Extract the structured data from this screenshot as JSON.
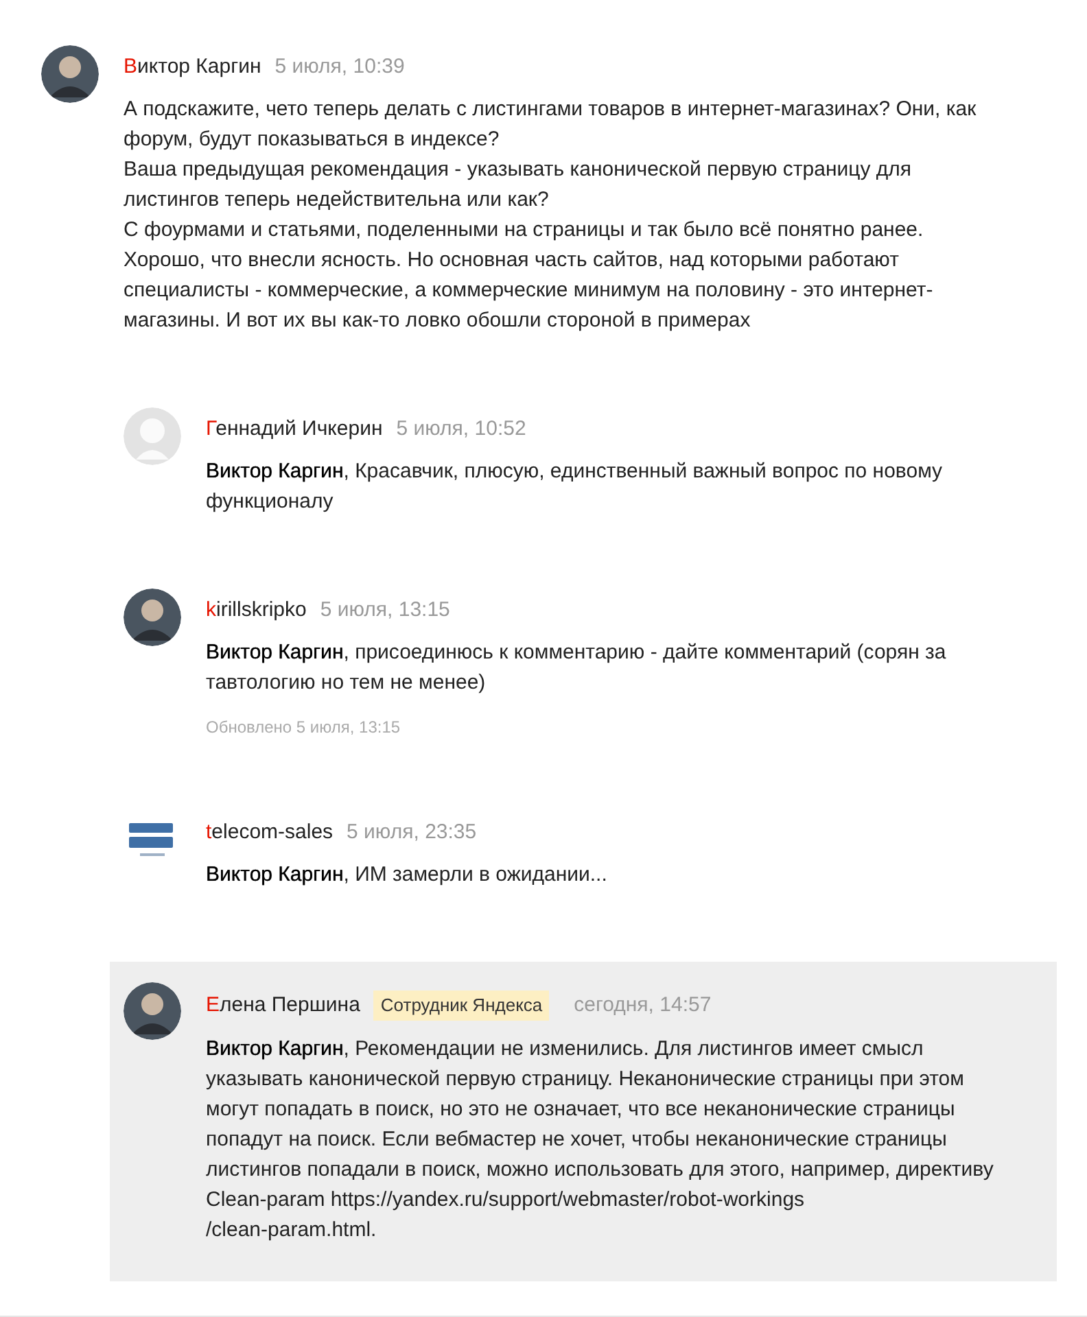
{
  "comments": [
    {
      "author": "Виктор Каргин",
      "time": "5 июля, 10:39",
      "reply": false,
      "highlighted": false,
      "text": "А подскажите, чето теперь делать с листингами товаров в интернет-магазинах? Они, как форум, будут показываться в индексе?\nВаша предыдущая рекомендация - указывать канонической первую страницу для листингов теперь недействительна или как?\nС фоурмами и статьями, поделенными на страницы и так было всё понятно ранее.\nХорошо, что внесли ясность. Но основная часть сайтов, над которыми работают специалисты - коммерческие, а коммерческие минимум на половину - это интернет-магазины. И вот их вы как-то ловко обошли стороной в примерах"
    },
    {
      "author": "Геннадий Ичкерин",
      "avatar": {
        "kind": "default"
      },
      "time": "5 июля, 10:52",
      "reply": true,
      "highlighted": false,
      "text": "**Виктор Каргин**, Красавчик, плюсую, единственный важный вопрос по новому функционалу"
    },
    {
      "author": "kirillskripko",
      "time": "5 июля, 13:15",
      "reply": true,
      "highlighted": false,
      "text": "**Виктор Каргин**, присоединюсь к комментарию - дайте комментарий (сорян за тавтологию но тем не менее)",
      "updated": "Обновлено 5 июля, 13:15"
    },
    {
      "author": "telecom-sales",
      "avatar": {
        "kind": "logo"
      },
      "time": "5 июля, 23:35",
      "reply": true,
      "highlighted": false,
      "text": "**Виктор Каргин**,  ИМ замерли в ожидании..."
    },
    {
      "author": "Елена Першина",
      "badge": "Сотрудник Яндекса",
      "time": "сегодня, 14:57",
      "reply": true,
      "highlighted": true,
      "text": "**Виктор Каргин**, Рекомендации не изменились. Для листингов имеет смысл указывать канонической первую страницу. Неканонические страницы при этом могут попадать в поиск, но это не означает, что все неканонические страницы попадут на поиск. Если вебмастер не хочет, чтобы неканонические страницы листингов попадали в поиск, можно использовать для этого, например, директиву Clean-param https://yandex.ru/support/webmaster/robot-workings\n/clean-param.html."
    }
  ]
}
